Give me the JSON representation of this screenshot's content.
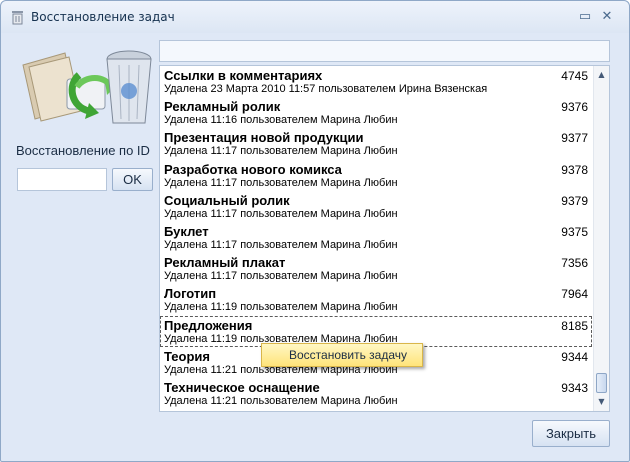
{
  "window": {
    "title": "Восстановление задач",
    "icons": {
      "title": "trash-icon",
      "minimize": "minimize-icon",
      "close": "close-icon",
      "recycle": "recycle-bin-icon"
    }
  },
  "left_panel": {
    "id_label": "Восстановление по ID",
    "id_input_value": "",
    "ok_label": "OK"
  },
  "search": {
    "value": ""
  },
  "tasks": [
    {
      "title": "Ссылки в комментариях",
      "subtitle": "Удалена 23 Марта 2010 11:57 пользователем Ирина Вязенская",
      "id": "4745"
    },
    {
      "title": "Рекламный ролик",
      "subtitle": "Удалена 11:16 пользователем Марина Любин",
      "id": "9376"
    },
    {
      "title": "Презентация новой продукции",
      "subtitle": "Удалена 11:17 пользователем Марина Любин",
      "id": "9377"
    },
    {
      "title": "Разработка нового комикса",
      "subtitle": "Удалена 11:17 пользователем Марина Любин",
      "id": "9378"
    },
    {
      "title": "Социальный ролик",
      "subtitle": "Удалена 11:17 пользователем Марина Любин",
      "id": "9379"
    },
    {
      "title": "Буклет",
      "subtitle": "Удалена 11:17 пользователем Марина Любин",
      "id": "9375"
    },
    {
      "title": "Рекламный плакат",
      "subtitle": "Удалена 11:17 пользователем Марина Любин",
      "id": "7356"
    },
    {
      "title": "Логотип",
      "subtitle": "Удалена 11:19 пользователем Марина Любин",
      "id": "7964"
    },
    {
      "title": "Предложения",
      "subtitle": "Удалена 11:19 пользователем Марина Любин",
      "id": "8185"
    },
    {
      "title": "Теория",
      "subtitle": "Удалена 11:21 пользователем Марина Любин",
      "id": "9344"
    },
    {
      "title": "Техническое оснащение",
      "subtitle": "Удалена 11:21 пользователем Марина Любин",
      "id": "9343"
    }
  ],
  "context_menu": {
    "item_label": "Восстановить задачу"
  },
  "footer": {
    "close_label": "Закрыть"
  }
}
